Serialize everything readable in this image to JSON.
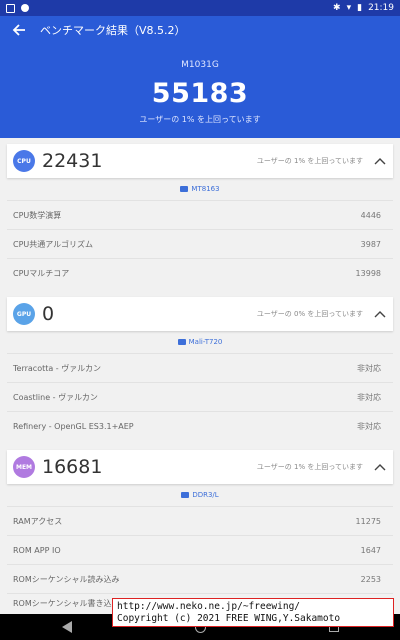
{
  "status_bar": {
    "time": "21:19"
  },
  "header": {
    "title": "ベンチマーク結果（V8.5.2）",
    "device": "M1031G",
    "total_score": "55183",
    "rank_text": "ユーザーの 1% を上回っています"
  },
  "sections": [
    {
      "badge": "CPU",
      "badge_color": "#4a78e8",
      "score": "22431",
      "rank": "ユーザーの 1% を上回っています",
      "chip": "MT8163",
      "rows": [
        {
          "label": "CPU数学演算",
          "value": "4446"
        },
        {
          "label": "CPU共通アルゴリズム",
          "value": "3987"
        },
        {
          "label": "CPUマルチコア",
          "value": "13998"
        }
      ]
    },
    {
      "badge": "GPU",
      "badge_color": "#5aa3e8",
      "score": "0",
      "rank": "ユーザーの 0% を上回っています",
      "chip": "Mali-T720",
      "rows": [
        {
          "label": "Terracotta - ヴァルカン",
          "value": "非対応"
        },
        {
          "label": "Coastline - ヴァルカン",
          "value": "非対応"
        },
        {
          "label": "Refinery - OpenGL ES3.1+AEP",
          "value": "非対応"
        }
      ]
    },
    {
      "badge": "MEM",
      "badge_color": "#b07ae0",
      "score": "16681",
      "rank": "ユーザーの 1% を上回っています",
      "chip": "DDR3/L",
      "rows": [
        {
          "label": "RAMアクセス",
          "value": "11275"
        },
        {
          "label": "ROM APP IO",
          "value": "1647"
        },
        {
          "label": "ROMシーケンシャル読み込み",
          "value": "2253"
        },
        {
          "label": "ROMシーケンシャル書き込み",
          "value": ""
        }
      ]
    }
  ],
  "credit": {
    "line1": "http://www.neko.ne.jp/~freewing/",
    "line2": "Copyright (c) 2021 FREE WING,Y.Sakamoto"
  }
}
